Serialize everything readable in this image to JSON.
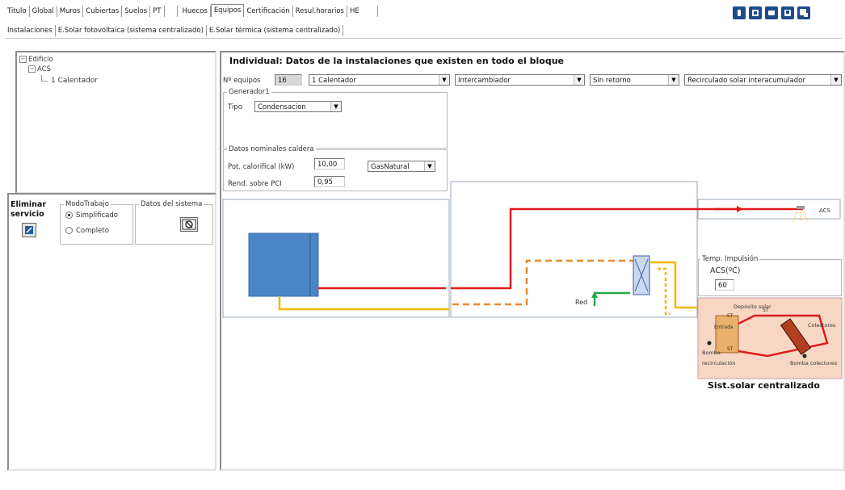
{
  "top_tabs": [
    "Titulo",
    "Global",
    "Muros",
    "Cubiertas",
    "Suelos",
    "PT",
    "Huecos",
    "Equipos",
    "Certificación",
    "Resul.horarios",
    "HE"
  ],
  "active_top_tab": "Equipos",
  "sub_tabs": [
    "Instalaciones",
    "E.Solar fotovoltaica (sistema centralizado)",
    "E.Solar térmica  (sistema centralizado)"
  ],
  "toolbar_icons": [
    "info-icon",
    "document-icon",
    "open-icon",
    "save-icon",
    "copy-icon"
  ],
  "tree": {
    "root": "Edificio",
    "child": "ACS",
    "leaf": "1 Calentador"
  },
  "left_controls": {
    "delete_line1": "Eliminar",
    "delete_line2": "servicio",
    "mode_legend": "ModoTrabajo",
    "mode_options": [
      "Simplificado",
      "Completo"
    ],
    "mode_selected": "Simplificado",
    "system_data_legend": "Datos del sistema"
  },
  "main": {
    "title": "Individual: Datos de la instalaciones que existen en todo el bloque",
    "equipos_label": "Nº equipos",
    "equipos_value": "16",
    "select_equipment": "1 Calentador",
    "select_exchange": "Intercambiador",
    "select_return": "Sin retorno",
    "select_recirc": "Recirculado solar interacumulador",
    "generator_legend": "Generador1",
    "tipo_label": "Tipo",
    "tipo_value": "Condensacion",
    "nominal_legend": "Datos nominales caldera",
    "pot_label": "Pot. calorifical (kW)",
    "pot_value": "10,00",
    "fuel_value": "GasNatural",
    "rend_label": "Rend. sobre PCI",
    "rend_value": "0,95"
  },
  "diagram": {
    "acs_label": "ACS",
    "red_label": "Red",
    "temp_legend": "Temp. Impulsión",
    "temp_label": "ACS(ºC)",
    "temp_value": "60",
    "solar_tank_label": "Depósito solar",
    "collectors_label": "Colectores",
    "recirc_pump_line1": "Bomba",
    "recirc_pump_line2": "recirculación",
    "collector_pump_label": "Bomba colectores",
    "st_label1": "ST",
    "st_label2": "ST",
    "st_label3": "ST",
    "entrada_label": "Entrada",
    "solar_system_label": "Sist.solar centralizado"
  },
  "colors": {
    "hot_line": "#e01b1b",
    "cold_line": "#f2b705",
    "return_dashed": "#e88a2b",
    "network_green": "#2aa84a",
    "heater_blue": "#4a85c8",
    "solar_bg": "#f7d7c4",
    "toolbar_blue": "#1d4b8a"
  }
}
